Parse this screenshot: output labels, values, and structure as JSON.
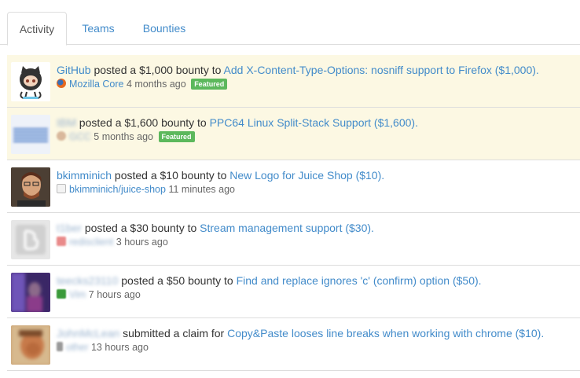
{
  "tabs": [
    {
      "label": "Activity",
      "active": true
    },
    {
      "label": "Teams",
      "active": false
    },
    {
      "label": "Bounties",
      "active": false
    }
  ],
  "colors": {
    "link": "#428bca",
    "featured_bg": "#fcf8e3",
    "badge": "#5cb85c"
  },
  "feed": [
    {
      "user": "GitHub",
      "action": "posted a $1,000 bounty to",
      "target": "Add X-Content-Type-Options: nosniff support to Firefox ($1,000).",
      "project": "Mozilla Core",
      "time": "4 months ago",
      "badge": "Featured",
      "avatar_icon": "github-octocat-icon"
    },
    {
      "user": "IBM",
      "action": "posted a $1,600 bounty to",
      "target": "PPC64 Linux Split-Stack Support ($1,600).",
      "project": "GCC",
      "time": "5 months ago",
      "badge": "Featured",
      "avatar_icon": "ibm-logo"
    },
    {
      "user": "bkimminich",
      "action": "posted a $10 bounty to",
      "target": "New Logo for Juice Shop ($10).",
      "project": "bkimminich/juice-shop",
      "time": "11 minutes ago",
      "avatar_icon": "user-photo"
    },
    {
      "user": "t1ber",
      "action": "posted a $30 bounty to",
      "target": "Stream management support ($30).",
      "project": "redisclient",
      "time": "3 hours ago",
      "avatar_icon": "default-avatar-icon"
    },
    {
      "user": "teecks23110",
      "action": "posted a $50 bounty to",
      "target": "Find and replace ignores 'c' (confirm) option ($50).",
      "project": "Vim",
      "time": "7 hours ago",
      "avatar_icon": "user-photo"
    },
    {
      "user": "JohnMcLean",
      "action": "submitted a claim for",
      "target": "Copy&Paste looses line breaks when working with chrome ($10).",
      "project": "other",
      "time": "13 hours ago",
      "avatar_icon": "user-photo"
    }
  ]
}
